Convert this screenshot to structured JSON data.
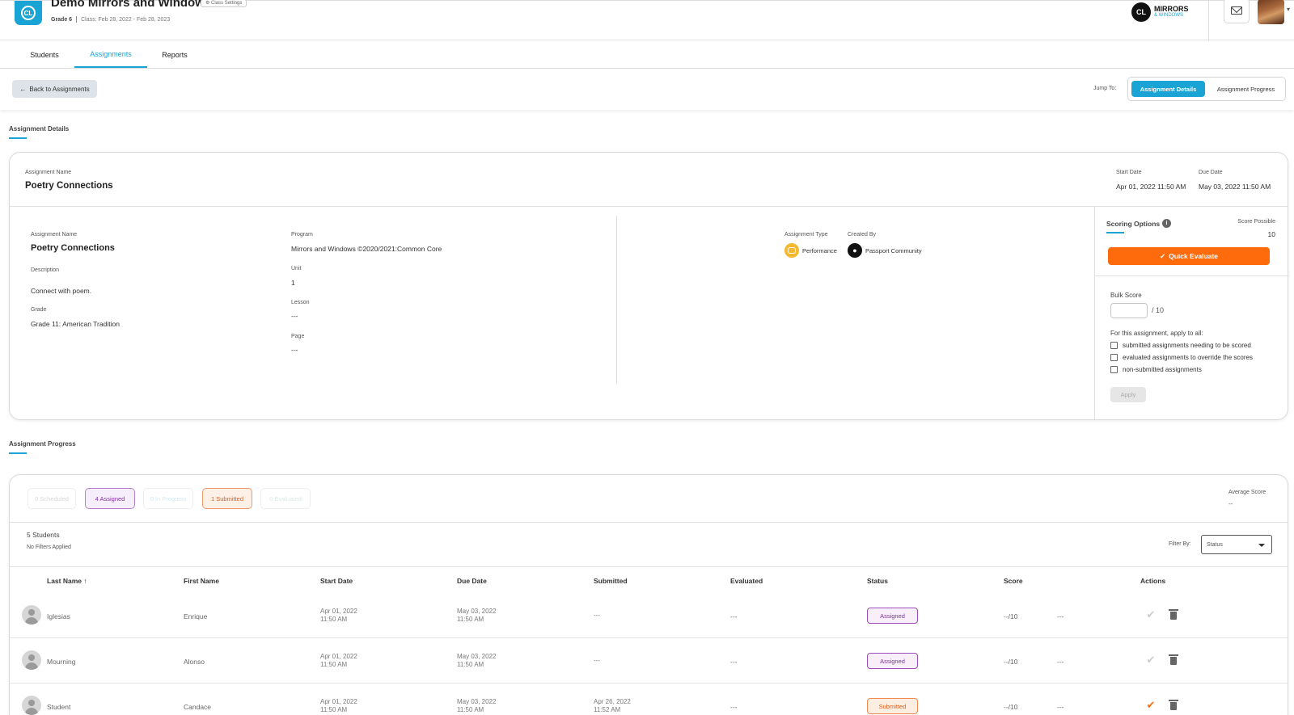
{
  "header": {
    "logo_text": "CL",
    "class_title": "Demo Mirrors and Windows",
    "class_settings_label": "⚙ Class Settings",
    "grade": "Grade 6",
    "class_dates": "Class: Feb 28, 2022 - Feb 28, 2023",
    "brand_logo_text": "CL",
    "brand_line1": "MIRRORS",
    "brand_line2": "& WINDOWS"
  },
  "tabs": [
    {
      "label": "Students"
    },
    {
      "label": "Assignments"
    },
    {
      "label": "Reports"
    }
  ],
  "toolbar": {
    "back_label": "Back to Assignments",
    "jump_to": "Jump To:",
    "jump_details": "Assignment Details",
    "jump_progress": "Assignment Progress"
  },
  "details": {
    "section_title": "Assignment Details",
    "header_name_label": "Assignment Name",
    "header_name": "Poetry Connections",
    "start_date_label": "Start Date",
    "start_date": "Apr 01, 2022 11:50 AM",
    "due_date_label": "Due Date",
    "due_date": "May 03, 2022 11:50 AM",
    "name_label": "Assignment Name",
    "name": "Poetry Connections",
    "description_label": "Description",
    "description": "Connect with poem.",
    "grade_label": "Grade",
    "grade": "Grade 11: American Tradition",
    "program_label": "Program",
    "program": "Mirrors and Windows ©2020/2021:Common Core",
    "unit_label": "Unit",
    "unit": "1",
    "lesson_label": "Lesson",
    "lesson": "---",
    "page_label": "Page",
    "page": "---",
    "type_label": "Assignment Type",
    "type": "Performance",
    "created_by_label": "Created By",
    "created_by": "Passport Community"
  },
  "scoring": {
    "title": "Scoring Options",
    "score_possible_label": "Score Possible",
    "score_possible": "10",
    "quick_evaluate": "Quick Evaluate",
    "bulk_score_label": "Bulk Score",
    "bulk_out_of": "/ 10",
    "apply_all_label": "For this assignment, apply to all:",
    "options": [
      "submitted assignments needing to be scored",
      "evaluated assignments to override the scores",
      "non-submitted assignments"
    ],
    "apply_label": "Apply"
  },
  "progress": {
    "section_title": "Assignment Progress",
    "pills": [
      "0 Scheduled",
      "4 Assigned",
      "0 In Progress",
      "1 Submitted",
      "0 Evaluated"
    ],
    "average_score_label": "Average Score",
    "average_score": "--",
    "students_count": "5 Students",
    "filters_applied": "No Filters Applied",
    "filter_by_label": "Filter By:",
    "filter_value": "Status",
    "columns": [
      "Last Name ↑",
      "First Name",
      "Start Date",
      "Due Date",
      "Submitted",
      "Evaluated",
      "Status",
      "Score",
      "Actions"
    ],
    "rows": [
      {
        "last": "Iglesias",
        "first": "Enrique",
        "start_date": "Apr 01, 2022",
        "start_time": "11:50 AM",
        "due_date": "May 03, 2022",
        "due_time": "11:50 AM",
        "submitted_date": "---",
        "submitted_time": "",
        "evaluated": "---",
        "status": "Assigned",
        "score": "--/10",
        "extra": "---"
      },
      {
        "last": "Mourning",
        "first": "Alonso",
        "start_date": "Apr 01, 2022",
        "start_time": "11:50 AM",
        "due_date": "May 03, 2022",
        "due_time": "11:50 AM",
        "submitted_date": "---",
        "submitted_time": "",
        "evaluated": "---",
        "status": "Assigned",
        "score": "--/10",
        "extra": "---"
      },
      {
        "last": "Student",
        "first": "Candace",
        "start_date": "Apr 01, 2022",
        "start_time": "11:50 AM",
        "due_date": "May 03, 2022",
        "due_time": "11:50 AM",
        "submitted_date": "Apr 26, 2022",
        "submitted_time": "11:52 AM",
        "evaluated": "---",
        "status": "Submitted",
        "score": "--/10",
        "extra": "---"
      }
    ]
  },
  "colors": {
    "accent": "#1aa3d5",
    "quick_evaluate": "#fd6b0d",
    "assigned": "#8a2da8",
    "submitted": "#e05a12"
  }
}
